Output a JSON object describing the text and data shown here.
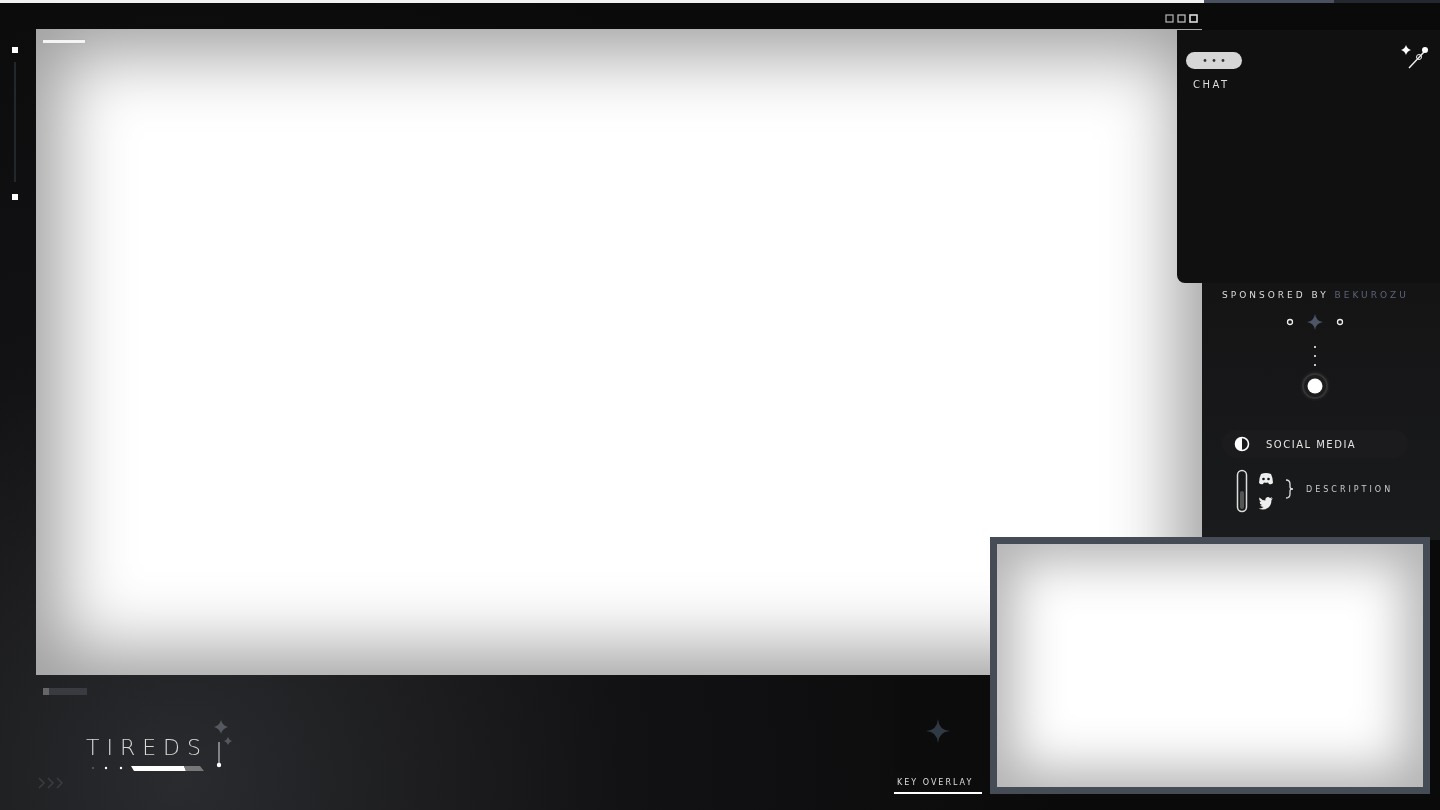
{
  "chat": {
    "title": "CHAT"
  },
  "sponsor": {
    "prefix": "SPONSORED BY",
    "name": "BEKUROZU"
  },
  "social": {
    "title": "SOCIAL MEDIA",
    "description": "DESCRIPTION"
  },
  "branding": {
    "name": "TIREDS"
  },
  "key_overlay": {
    "label": "KEY OVERLAY"
  }
}
